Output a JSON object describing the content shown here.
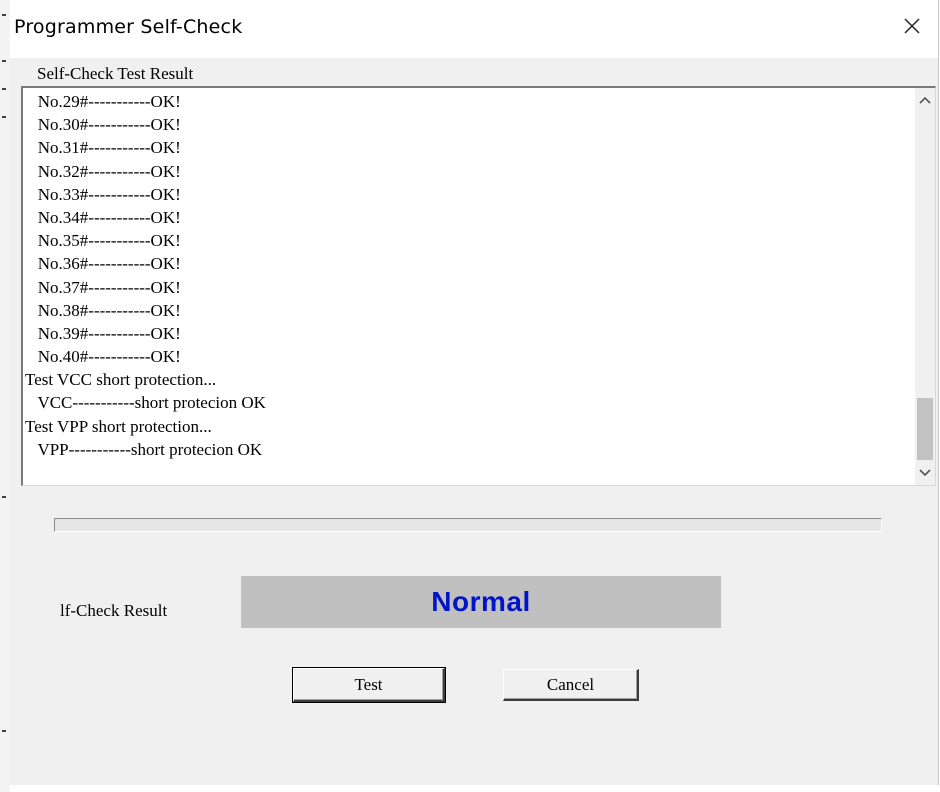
{
  "window": {
    "title": "Programmer Self-Check"
  },
  "results_group": {
    "label": "Self-Check Test Result",
    "lines": [
      "   No.29#-----------OK!",
      "   No.30#-----------OK!",
      "   No.31#-----------OK!",
      "   No.32#-----------OK!",
      "   No.33#-----------OK!",
      "   No.34#-----------OK!",
      "   No.35#-----------OK!",
      "   No.36#-----------OK!",
      "   No.37#-----------OK!",
      "   No.38#-----------OK!",
      "   No.39#-----------OK!",
      "   No.40#-----------OK!",
      "Test VCC short protection...",
      "   VCC-----------short protecion OK",
      "Test VPP short protection...",
      "   VPP-----------short protecion OK"
    ]
  },
  "progress": {
    "value_percent": 0
  },
  "self_check": {
    "label": "lf-Check Result",
    "value": "Normal",
    "value_color": "#0014c8"
  },
  "buttons": {
    "test_label": "Test",
    "cancel_label": "Cancel"
  },
  "icons": {
    "close": "close-icon",
    "scroll_up": "chevron-up-icon",
    "scroll_down": "chevron-down-icon"
  }
}
